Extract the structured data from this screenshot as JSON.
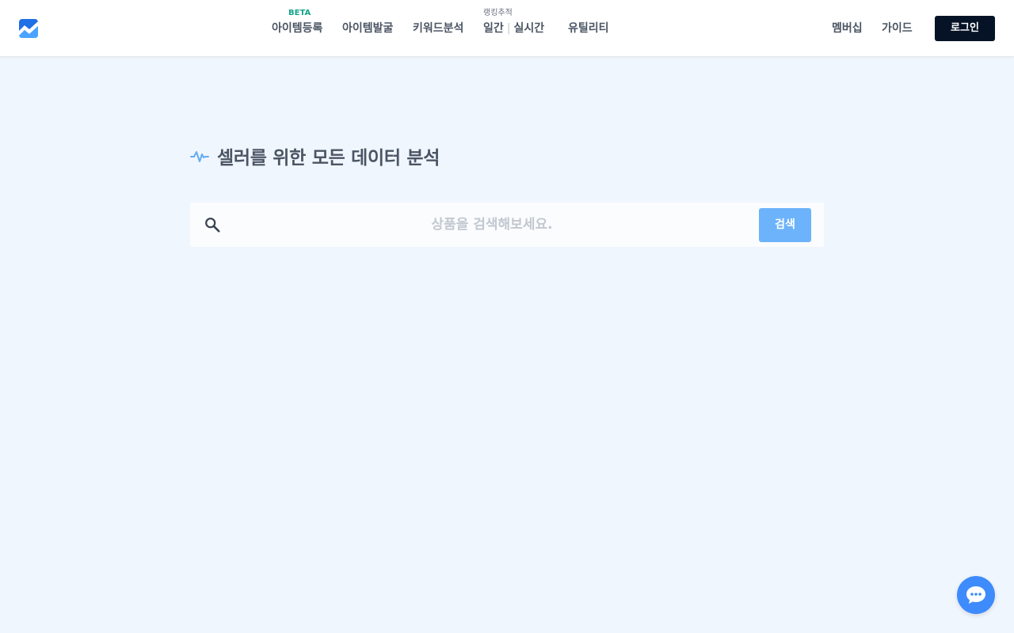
{
  "header": {
    "logo": "brand-logo",
    "nav": {
      "item_register": {
        "label": "아이템등록",
        "badge": "BETA"
      },
      "item_discover": {
        "label": "아이템발굴"
      },
      "keyword_analysis": {
        "label": "키워드분석"
      },
      "ranking": {
        "badge": "랭킹추적",
        "daily": "일간",
        "separator": "|",
        "realtime": "실시간"
      },
      "utility": {
        "label": "유틸리티"
      }
    },
    "membership": "멤버십",
    "guide": "가이드",
    "login": "로그인"
  },
  "hero": {
    "title": "셀러를 위한 모든 데이터 분석",
    "icon": "pulse-icon"
  },
  "search": {
    "placeholder": "상품을 검색해보세요.",
    "value": "",
    "button": "검색",
    "icon": "search-icon"
  },
  "chat": {
    "icon": "chat-icon"
  },
  "colors": {
    "background": "#f0f6fe",
    "accent": "#3d8bfd",
    "search_button": "#6cb3fb",
    "login_button": "#061326",
    "beta_badge": "#14a38b"
  }
}
